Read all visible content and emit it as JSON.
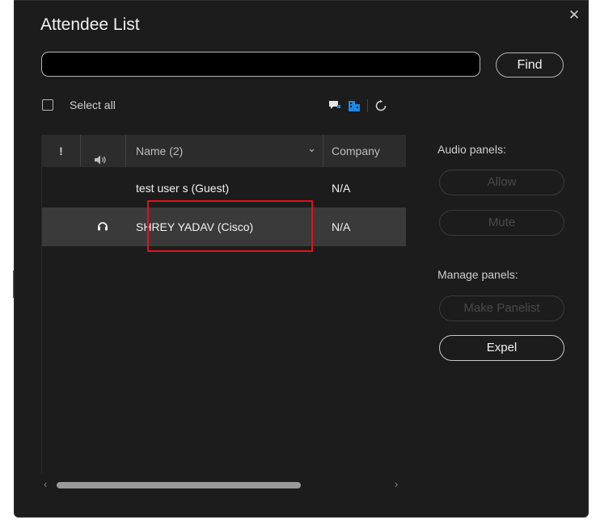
{
  "dialog": {
    "title": "Attendee List",
    "close_glyph": "✕"
  },
  "search": {
    "value": "",
    "placeholder": "",
    "find_label": "Find"
  },
  "select_all": {
    "label": "Select all",
    "checked": false
  },
  "toolbar_icons": [
    "chat-icon",
    "attendee-info-icon",
    "refresh-icon"
  ],
  "table": {
    "columns": [
      {
        "key": "alert",
        "label": "!"
      },
      {
        "key": "audio",
        "label": "🔈"
      },
      {
        "key": "name",
        "label": "Name (2)"
      },
      {
        "key": "sort",
        "label": "⌄"
      },
      {
        "key": "company",
        "label": "Company"
      }
    ],
    "rows": [
      {
        "audio_icon": "",
        "name": "test user s (Guest)",
        "company": "N/A",
        "selected": false
      },
      {
        "audio_icon": "headset-icon",
        "name": "SHREY YADAV (Cisco)",
        "company": "N/A",
        "selected": true
      }
    ],
    "scroll_left": "‹",
    "scroll_right": "›"
  },
  "audio_panels": {
    "label": "Audio panels:",
    "buttons": [
      {
        "label": "Allow",
        "enabled": false
      },
      {
        "label": "Mute",
        "enabled": false
      }
    ]
  },
  "manage_panels": {
    "label": "Manage panels:",
    "buttons": [
      {
        "label": "Make Panelist",
        "enabled": false
      },
      {
        "label": "Expel",
        "enabled": true
      }
    ]
  },
  "colors": {
    "background": "#1c1c1c",
    "header": "#2c2c2c",
    "selected_row": "#3a3a3a",
    "highlight": "#e0121a",
    "accent": "#1e88e5"
  }
}
